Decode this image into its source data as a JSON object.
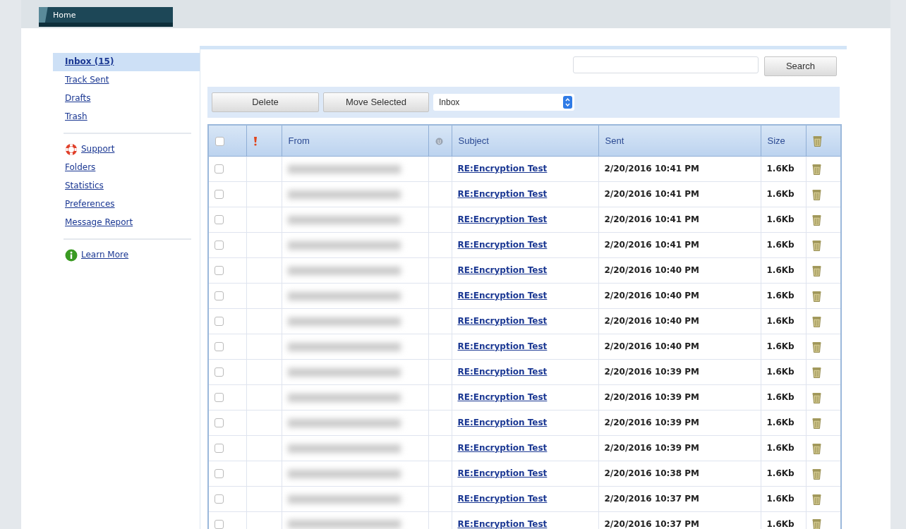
{
  "tabs": [
    {
      "label": "Home",
      "selected": true
    }
  ],
  "sidebar": {
    "sections": [
      {
        "items": [
          {
            "label": "Inbox (15)",
            "selected": true,
            "kind": "link"
          },
          {
            "label": "Track Sent",
            "selected": false,
            "kind": "link"
          },
          {
            "label": "Drafts",
            "selected": false,
            "kind": "link"
          },
          {
            "label": "Trash",
            "selected": false,
            "kind": "link"
          }
        ]
      },
      {
        "items": [
          {
            "label": "Support",
            "selected": false,
            "kind": "help-link"
          },
          {
            "label": "Folders",
            "selected": false,
            "kind": "link"
          },
          {
            "label": "Statistics",
            "selected": false,
            "kind": "link"
          },
          {
            "label": "Preferences",
            "selected": false,
            "kind": "link"
          },
          {
            "label": "Message Report",
            "selected": false,
            "kind": "link"
          }
        ]
      },
      {
        "items": [
          {
            "label": "Learn More",
            "selected": false,
            "kind": "info-link"
          }
        ]
      }
    ]
  },
  "search": {
    "button": "Search"
  },
  "toolbar": {
    "buttons": [
      "Delete",
      "Move Selected"
    ],
    "folder_select": {
      "value": "Inbox"
    }
  },
  "table": {
    "select_all": {
      "checked": false
    },
    "columns": [
      {
        "kind": "checkbox"
      },
      {
        "kind": "flag"
      },
      {
        "kind": "text",
        "label": "From"
      },
      {
        "kind": "attachment"
      },
      {
        "kind": "text",
        "label": "Subject"
      },
      {
        "kind": "text",
        "label": "Sent"
      },
      {
        "kind": "text",
        "label": "Size"
      },
      {
        "kind": "trash"
      }
    ],
    "rows": [
      {
        "checked": false,
        "subject": "RE:Encryption Test",
        "sent": "2/20/2016 10:41 PM",
        "size": "1.6Kb"
      },
      {
        "checked": false,
        "subject": "RE:Encryption Test",
        "sent": "2/20/2016 10:41 PM",
        "size": "1.6Kb"
      },
      {
        "checked": false,
        "subject": "RE:Encryption Test",
        "sent": "2/20/2016 10:41 PM",
        "size": "1.6Kb"
      },
      {
        "checked": false,
        "subject": "RE:Encryption Test",
        "sent": "2/20/2016 10:41 PM",
        "size": "1.6Kb"
      },
      {
        "checked": false,
        "subject": "RE:Encryption Test",
        "sent": "2/20/2016 10:40 PM",
        "size": "1.6Kb"
      },
      {
        "checked": false,
        "subject": "RE:Encryption Test",
        "sent": "2/20/2016 10:40 PM",
        "size": "1.6Kb"
      },
      {
        "checked": false,
        "subject": "RE:Encryption Test",
        "sent": "2/20/2016 10:40 PM",
        "size": "1.6Kb"
      },
      {
        "checked": false,
        "subject": "RE:Encryption Test",
        "sent": "2/20/2016 10:40 PM",
        "size": "1.6Kb"
      },
      {
        "checked": false,
        "subject": "RE:Encryption Test",
        "sent": "2/20/2016 10:39 PM",
        "size": "1.6Kb"
      },
      {
        "checked": false,
        "subject": "RE:Encryption Test",
        "sent": "2/20/2016 10:39 PM",
        "size": "1.6Kb"
      },
      {
        "checked": false,
        "subject": "RE:Encryption Test",
        "sent": "2/20/2016 10:39 PM",
        "size": "1.6Kb"
      },
      {
        "checked": false,
        "subject": "RE:Encryption Test",
        "sent": "2/20/2016 10:39 PM",
        "size": "1.6Kb"
      },
      {
        "checked": false,
        "subject": "RE:Encryption Test",
        "sent": "2/20/2016 10:38 PM",
        "size": "1.6Kb"
      },
      {
        "checked": false,
        "subject": "RE:Encryption Test",
        "sent": "2/20/2016 10:37 PM",
        "size": "1.6Kb"
      },
      {
        "checked": false,
        "subject": "RE:Encryption Test",
        "sent": "2/20/2016 10:37 PM",
        "size": "1.6Kb"
      }
    ]
  }
}
